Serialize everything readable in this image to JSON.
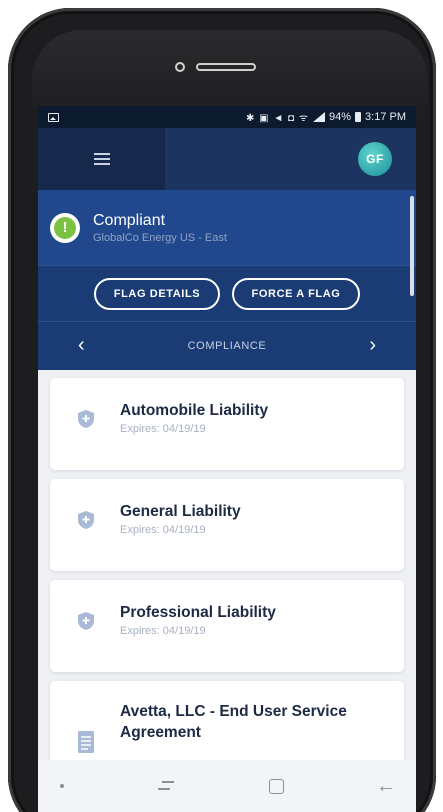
{
  "status_bar": {
    "system_icons": "✱ ▣ ◄ ◘ ᯤ",
    "battery": "94%",
    "time": "3:17 PM"
  },
  "header": {
    "avatar_initials": "GF"
  },
  "compliance": {
    "status": "Compliant",
    "company": "GlobalCo Energy US - East",
    "status_color": "#7cc242"
  },
  "actions": {
    "flag_details": "FLAG DETAILS",
    "force_a_flag": "FORCE A FLAG"
  },
  "section_nav": {
    "label": "COMPLIANCE",
    "prev_icon": "chevron-left-icon",
    "next_icon": "chevron-right-icon"
  },
  "items": [
    {
      "title": "Automobile Liability",
      "subtitle": "Expires: 04/19/19",
      "icon": "shield-icon"
    },
    {
      "title": "General Liability",
      "subtitle": "Expires: 04/19/19",
      "icon": "shield-icon"
    },
    {
      "title": "Professional Liability",
      "subtitle": "Expires: 04/19/19",
      "icon": "shield-icon"
    },
    {
      "title": "Avetta, LLC - End User Service Agreement",
      "subtitle": "",
      "icon": "document-icon"
    }
  ],
  "colors": {
    "header": "#1b3560",
    "panel": "#1a3b73",
    "accent_green": "#7cc242"
  }
}
